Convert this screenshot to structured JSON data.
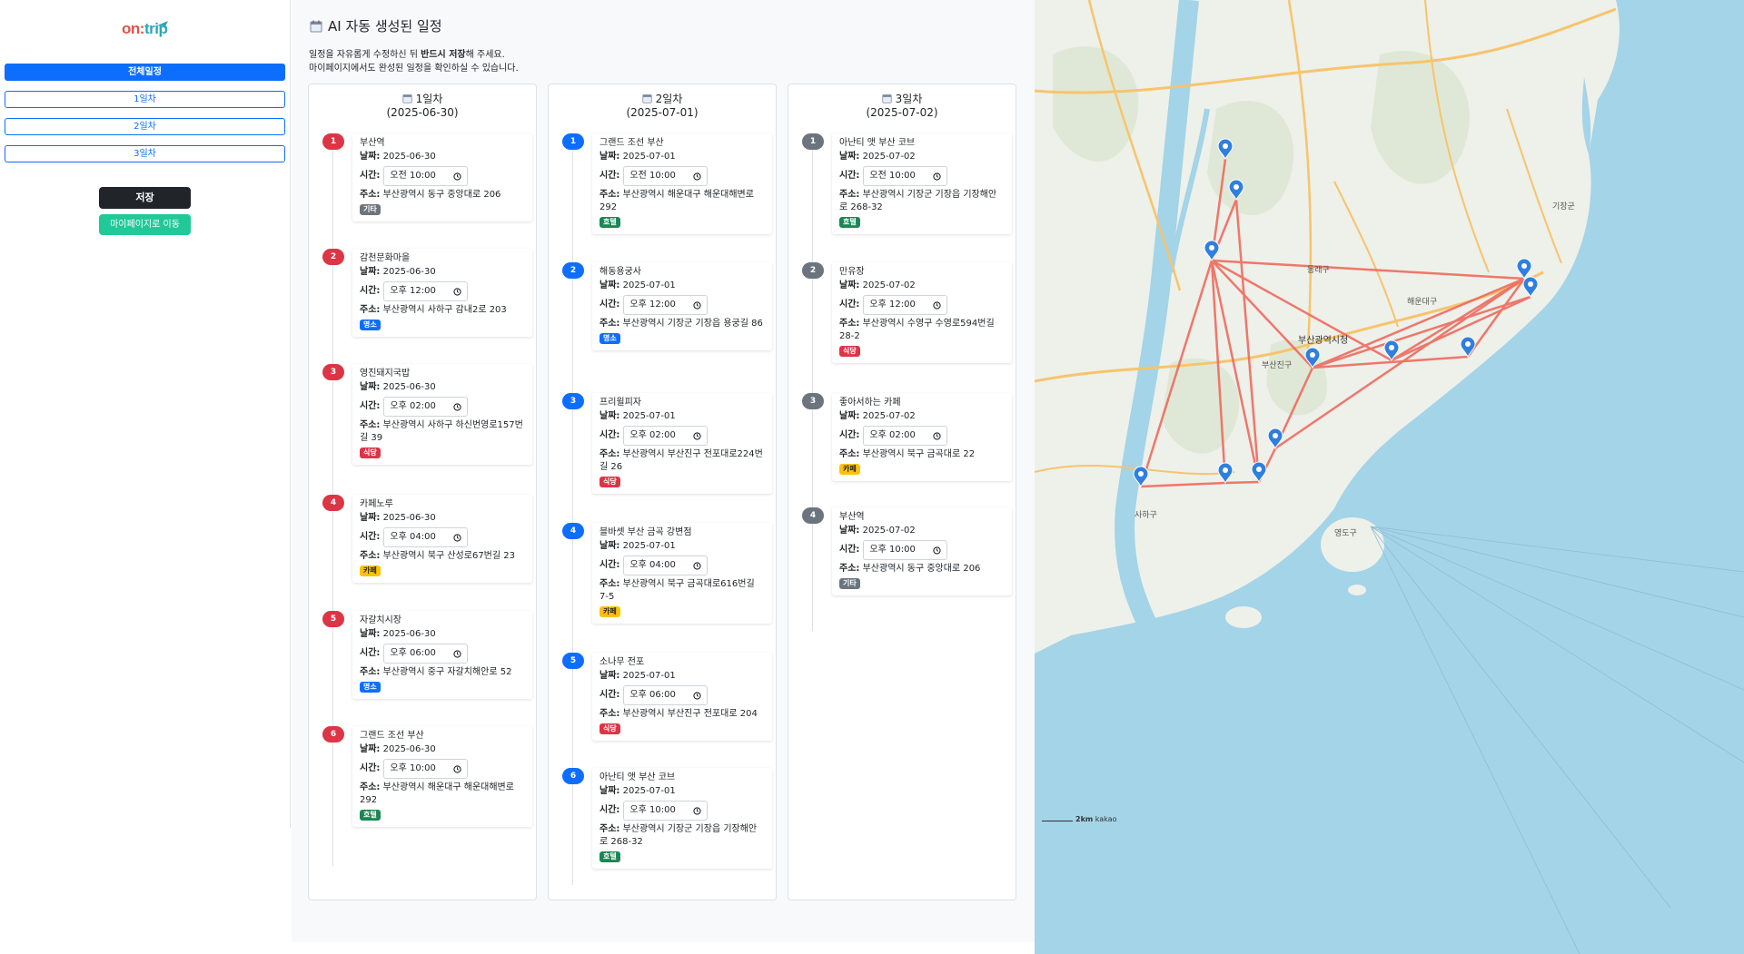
{
  "brand": {
    "logo_main": "on",
    "logo_tail": "trip"
  },
  "sidebar": {
    "nav": [
      {
        "label": "전체일정",
        "active": true
      },
      {
        "label": "1일차",
        "active": false
      },
      {
        "label": "2일차",
        "active": false
      },
      {
        "label": "3일차",
        "active": false
      }
    ],
    "save_label": "저장",
    "mypage_label": "마이페이지로 이동"
  },
  "main": {
    "title": "AI 자동 생성된 일정",
    "notice_line1_pre": "일정을 자유롭게 수정하신 뒤 ",
    "notice_line1_bold": "반드시 저장",
    "notice_line1_post": "해 주세요.",
    "notice_line2": "마이페이지에서도 완성된 일정을 확인하실 수 있습니다."
  },
  "labels": {
    "date": "날짜:",
    "time": "시간:",
    "address": "주소:"
  },
  "days": [
    {
      "title": "1일차",
      "date": "(2025-06-30)",
      "color": "#dc3545",
      "items": [
        {
          "num": "1",
          "name": "부산역",
          "date": "2025-06-30",
          "time": "오전 10:00",
          "address": "부산광역시 동구 중앙대로 206",
          "tag": "기타",
          "tag_class": "b-etc"
        },
        {
          "num": "2",
          "name": "감천문화마을",
          "date": "2025-06-30",
          "time": "오후 12:00",
          "address": "부산광역시 사하구 감내2로 203",
          "tag": "명소",
          "tag_class": "b-place"
        },
        {
          "num": "3",
          "name": "영진돼지국밥",
          "date": "2025-06-30",
          "time": "오후 02:00",
          "address": "부산광역시 사하구 하신번영로157번길 39",
          "tag": "식당",
          "tag_class": "b-food"
        },
        {
          "num": "4",
          "name": "카페노루",
          "date": "2025-06-30",
          "time": "오후 04:00",
          "address": "부산광역시 북구 산성로67번길 23",
          "tag": "카페",
          "tag_class": "b-cafe"
        },
        {
          "num": "5",
          "name": "자갈치시장",
          "date": "2025-06-30",
          "time": "오후 06:00",
          "address": "부산광역시 중구 자갈치해안로 52",
          "tag": "명소",
          "tag_class": "b-place"
        },
        {
          "num": "6",
          "name": "그랜드 조선 부산",
          "date": "2025-06-30",
          "time": "오후 10:00",
          "address": "부산광역시 해운대구 해운대해변로 292",
          "tag": "호텔",
          "tag_class": "b-hotel"
        }
      ]
    },
    {
      "title": "2일차",
      "date": "(2025-07-01)",
      "color": "#0d6efd",
      "items": [
        {
          "num": "1",
          "name": "그랜드 조선 부산",
          "date": "2025-07-01",
          "time": "오전 10:00",
          "address": "부산광역시 해운대구 해운대해변로 292",
          "tag": "호텔",
          "tag_class": "b-hotel"
        },
        {
          "num": "2",
          "name": "해동용궁사",
          "date": "2025-07-01",
          "time": "오후 12:00",
          "address": "부산광역시 기장군 기장읍 용궁길 86",
          "tag": "명소",
          "tag_class": "b-place"
        },
        {
          "num": "3",
          "name": "프리윌피자",
          "date": "2025-07-01",
          "time": "오후 02:00",
          "address": "부산광역시 부산진구 전포대로224번길 26",
          "tag": "식당",
          "tag_class": "b-food"
        },
        {
          "num": "4",
          "name": "블바셋 부산 금곡 강변점",
          "date": "2025-07-01",
          "time": "오후 04:00",
          "address": "부산광역시 북구 금곡대로616번길 7-5",
          "tag": "카페",
          "tag_class": "b-cafe"
        },
        {
          "num": "5",
          "name": "소나무 전포",
          "date": "2025-07-01",
          "time": "오후 06:00",
          "address": "부산광역시 부산진구 전포대로 204",
          "tag": "식당",
          "tag_class": "b-food"
        },
        {
          "num": "6",
          "name": "아난티 앳 부산 코브",
          "date": "2025-07-01",
          "time": "오후 10:00",
          "address": "부산광역시 기장군 기장읍 기장해안로 268-32",
          "tag": "호텔",
          "tag_class": "b-hotel"
        }
      ]
    },
    {
      "title": "3일차",
      "date": "(2025-07-02)",
      "color": "#6c757d",
      "items": [
        {
          "num": "1",
          "name": "아난티 앳 부산 코브",
          "date": "2025-07-02",
          "time": "오전 10:00",
          "address": "부산광역시 기장군 기장읍 기장해안로 268-32",
          "tag": "호텔",
          "tag_class": "b-hotel"
        },
        {
          "num": "2",
          "name": "만유장",
          "date": "2025-07-02",
          "time": "오후 12:00",
          "address": "부산광역시 수영구 수영로594번길 28-2",
          "tag": "식당",
          "tag_class": "b-food"
        },
        {
          "num": "3",
          "name": "좋아서하는 카페",
          "date": "2025-07-02",
          "time": "오후 02:00",
          "address": "부산광역시 북구 금곡대로 22",
          "tag": "카페",
          "tag_class": "b-cafe"
        },
        {
          "num": "4",
          "name": "부산역",
          "date": "2025-07-02",
          "time": "오후 10:00",
          "address": "부산광역시 동구 중앙대로 206",
          "tag": "기타",
          "tag_class": "b-etc"
        }
      ]
    }
  ],
  "map": {
    "colors": {
      "sea": "#a3d4e8",
      "land": "#eef0ea",
      "route": "#ee6a5e",
      "marker": "#2f7fe0"
    },
    "labels": [
      "부산광역시청",
      "해운대구",
      "사하구",
      "영도구",
      "기장군",
      "부산진구",
      "동래구"
    ],
    "scale_text": "2km",
    "attribution": "kakao"
  }
}
